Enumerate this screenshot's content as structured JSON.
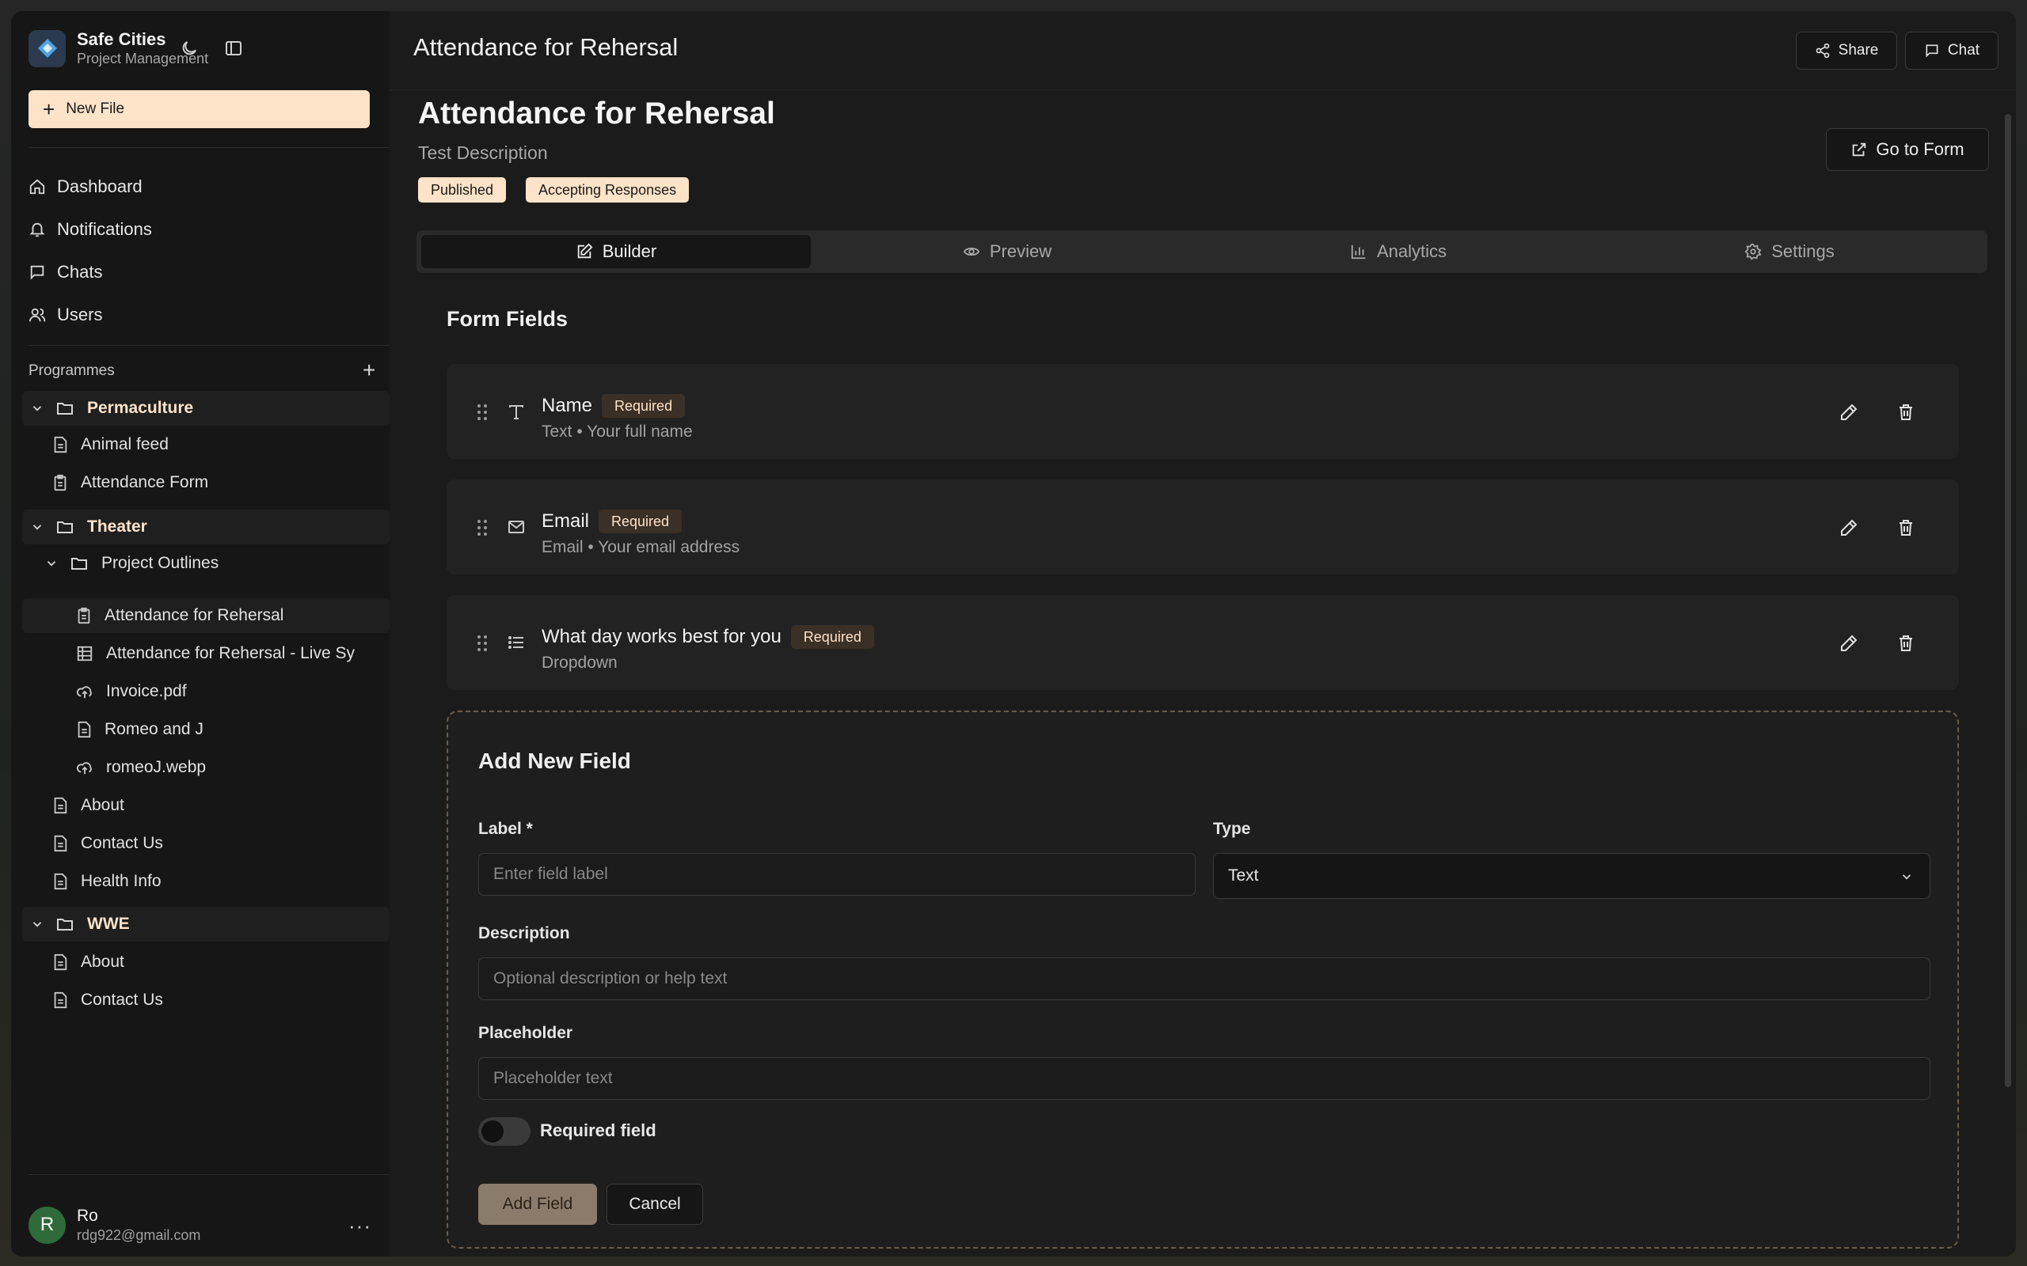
{
  "brand": {
    "title": "Safe Cities",
    "subtitle": "Project Management",
    "icons": [
      "moon-icon",
      "sidebar-toggle-icon"
    ]
  },
  "sidebar": {
    "new_file_label": "New File",
    "nav": [
      {
        "label": "Dashboard",
        "icon": "home-icon"
      },
      {
        "label": "Notifications",
        "icon": "bell-icon"
      },
      {
        "label": "Chats",
        "icon": "chat-icon"
      },
      {
        "label": "Users",
        "icon": "users-icon"
      }
    ],
    "programmes_label": "Programmes",
    "tree": {
      "permaculture": {
        "label": "Permaculture",
        "items": [
          "Animal feed",
          "Attendance Form"
        ]
      },
      "theater": {
        "label": "Theater",
        "project_outlines": {
          "label": "Project Outlines",
          "items": [
            "Attendance for Rehersal",
            "Attendance for Rehersal - Live Sy",
            "Invoice.pdf",
            "Romeo and J",
            "romeoJ.webp"
          ]
        },
        "items": [
          "About",
          "Contact Us",
          "Health Info"
        ]
      },
      "wwe": {
        "label": "WWE",
        "items": [
          "About",
          "Contact Us"
        ]
      }
    },
    "user": {
      "initial": "R",
      "name": "Ro",
      "email": "rdg922@gmail.com"
    }
  },
  "topbar": {
    "title": "Attendance for Rehersal",
    "share_label": "Share",
    "chat_label": "Chat"
  },
  "page": {
    "title": "Attendance for Rehersal",
    "description": "Test Description",
    "badges": [
      "Published",
      "Accepting Responses"
    ],
    "go_to_form_label": "Go to Form"
  },
  "tabs": [
    {
      "label": "Builder",
      "icon": "edit-icon",
      "active": true
    },
    {
      "label": "Preview",
      "icon": "eye-icon",
      "active": false
    },
    {
      "label": "Analytics",
      "icon": "bar-chart-icon",
      "active": false
    },
    {
      "label": "Settings",
      "icon": "gear-icon",
      "active": false
    }
  ],
  "form_fields": {
    "title": "Form Fields",
    "fields": [
      {
        "label": "Name",
        "badge": "Required",
        "meta": "Text • Your full name",
        "icon": "text-type-icon"
      },
      {
        "label": "Email",
        "badge": "Required",
        "meta": "Email • Your email address",
        "icon": "mail-icon"
      },
      {
        "label": "What day works best for you",
        "badge": "Required",
        "meta": "Dropdown",
        "icon": "list-icon"
      }
    ]
  },
  "add_field": {
    "title": "Add New Field",
    "label_label": "Label *",
    "label_placeholder": "Enter field label",
    "type_label": "Type",
    "type_value": "Text",
    "description_label": "Description",
    "description_placeholder": "Optional description or help text",
    "placeholder_label": "Placeholder",
    "placeholder_placeholder": "Placeholder text",
    "required_label": "Required field",
    "required_on": false,
    "add_button": "Add Field",
    "cancel_button": "Cancel"
  },
  "colors": {
    "accent": "#fde3c8",
    "background": "#1b1b1b",
    "sidebar": "#161616"
  }
}
